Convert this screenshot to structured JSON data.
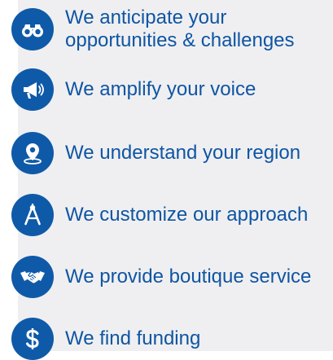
{
  "items": [
    {
      "icon": "binoculars-icon",
      "label_line1": "We anticipate your",
      "label_line2": "opportunities & challenges"
    },
    {
      "icon": "megaphone-icon",
      "label": "We amplify your voice"
    },
    {
      "icon": "map-pin-icon",
      "label": "We understand your region"
    },
    {
      "icon": "drafting-compass-icon",
      "label": "We customize our approach"
    },
    {
      "icon": "handshake-icon",
      "label": "We provide boutique service"
    },
    {
      "icon": "dollar-sign-icon",
      "label": "We find funding"
    }
  ],
  "colors": {
    "accent": "#0f5aa8",
    "text": "#0f55a3",
    "panel": "#efeff1",
    "background": "#ffffff"
  }
}
